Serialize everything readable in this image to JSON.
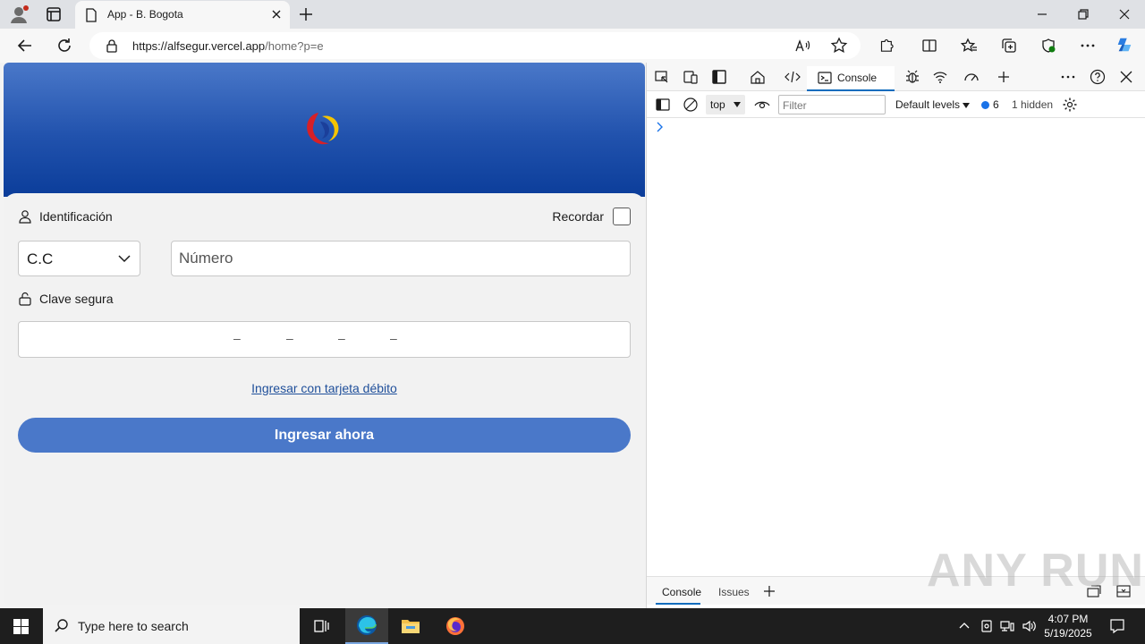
{
  "browser": {
    "tab_title": "App - B. Bogota",
    "url_host": "https://alfsegur.vercel.app",
    "url_path": "/home?p=e"
  },
  "page": {
    "identificacion_label": "Identificación",
    "recordar_label": "Recordar",
    "doc_type_value": "C.C",
    "numero_placeholder": "Número",
    "clave_label": "Clave segura",
    "pin_dashes": [
      "–",
      "–",
      "–",
      "–"
    ],
    "debit_link": "Ingresar con tarjeta débito",
    "submit_label": "Ingresar ahora",
    "colors": {
      "primary": "#4a78c9",
      "hero_top": "#4a78c9",
      "hero_bottom": "#0b3d9a",
      "link": "#1f4f9a"
    }
  },
  "devtools": {
    "console_tab": "Console",
    "context": "top",
    "filter_placeholder": "Filter",
    "levels": "Default levels",
    "message_count": "6",
    "hidden": "1 hidden",
    "bottom_tabs": [
      "Console",
      "Issues"
    ]
  },
  "watermark": "ANY RUN",
  "taskbar": {
    "search_placeholder": "Type here to search",
    "time": "4:07 PM",
    "date": "5/19/2025"
  }
}
